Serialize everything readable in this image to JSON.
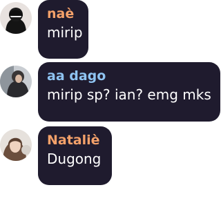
{
  "messages": [
    {
      "author": "naè",
      "text": "mirip",
      "name_color": "#f4a16a",
      "avatar_icon": "user-avatar-photo"
    },
    {
      "author": "aa dago",
      "text": "mirip sp? ian? emg mks",
      "name_color": "#8fc4f2",
      "avatar_icon": "user-avatar-photo"
    },
    {
      "author": "Nataliè",
      "text": "Dugong",
      "name_color": "#f4a16a",
      "avatar_icon": "user-avatar-photo"
    }
  ],
  "theme": {
    "bubble_background": "#1f1b2e",
    "message_text_color": "#ffffff"
  }
}
